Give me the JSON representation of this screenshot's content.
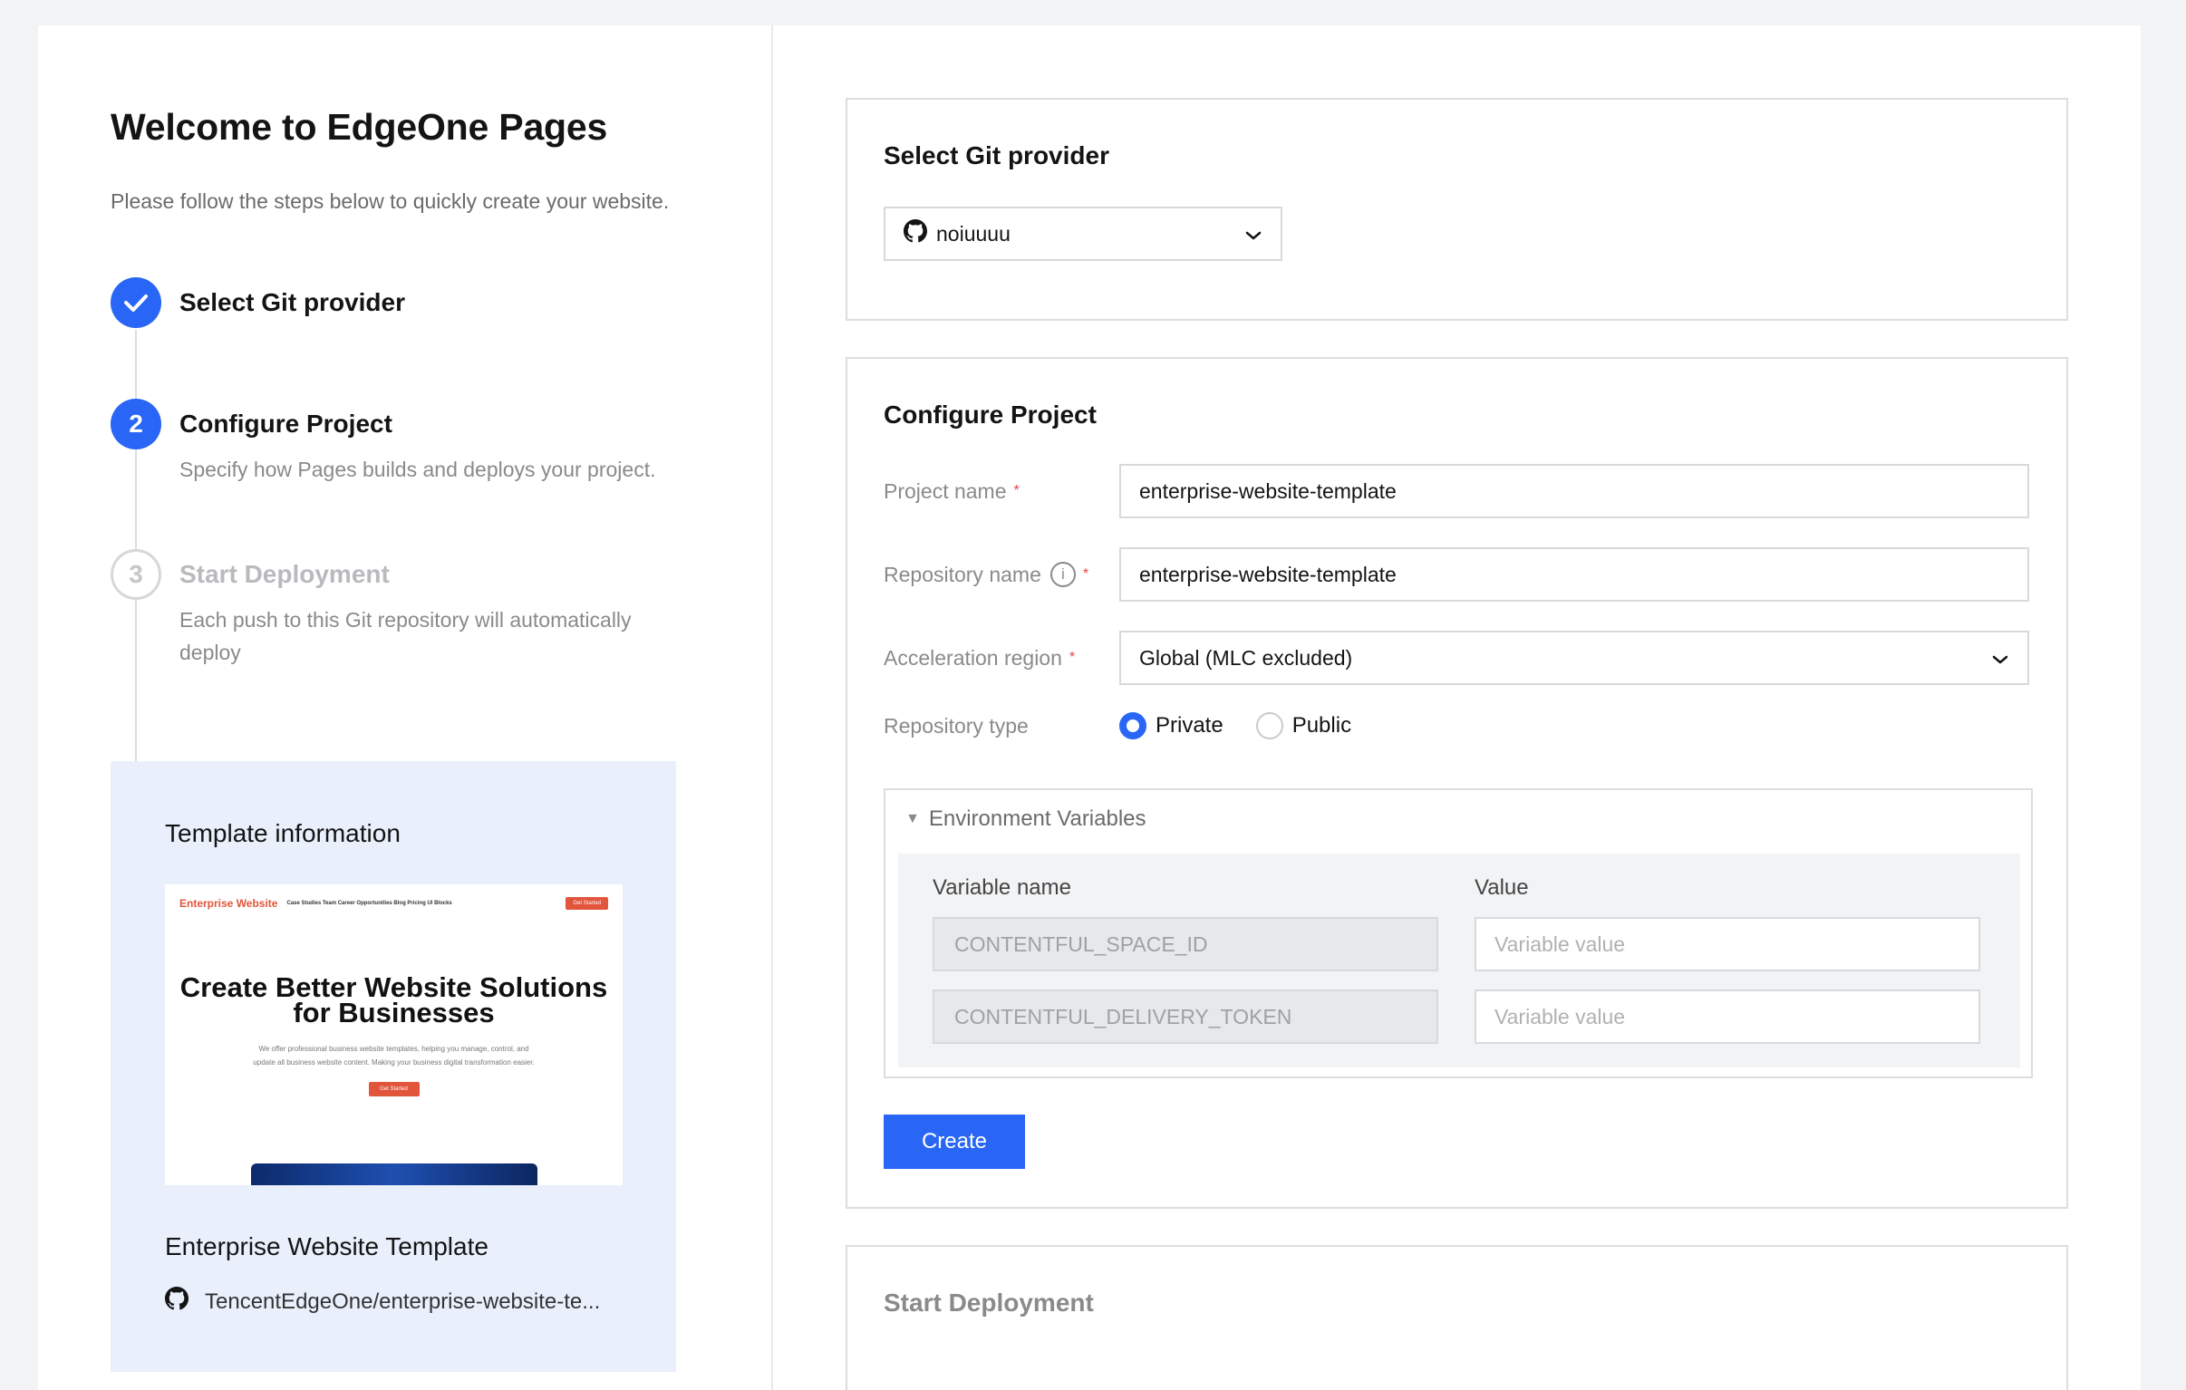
{
  "welcome": {
    "title": "Welcome to EdgeOne Pages",
    "subtitle": "Please follow the steps below to quickly create your website."
  },
  "steps": [
    {
      "number": "1",
      "title": "Select Git provider",
      "description": "",
      "state": "done"
    },
    {
      "number": "2",
      "title": "Configure Project",
      "description": "Specify how Pages builds and deploys your project.",
      "state": "active"
    },
    {
      "number": "3",
      "title": "Start Deployment",
      "description": "Each push to this Git repository will automatically deploy",
      "state": "pending"
    }
  ],
  "template": {
    "heading": "Template information",
    "preview": {
      "brand": "Enterprise Website",
      "links": "Case Studies Team Career Opportunities Blog Pricing UI Blocks",
      "nav_button": "Get Started",
      "hero": "Create Better Website Solutions for Businesses",
      "text": "We offer professional business website templates, helping you manage, control, and update all business website content. Making your business digital transformation easier.",
      "cta": "Get Started"
    },
    "name": "Enterprise Website Template",
    "repo": "TencentEdgeOne/enterprise-website-te..."
  },
  "git": {
    "title": "Select Git provider",
    "account": "noiuuuu"
  },
  "config": {
    "title": "Configure Project",
    "project_name_label": "Project name",
    "project_name_value": "enterprise-website-template",
    "repo_name_label": "Repository name",
    "repo_name_value": "enterprise-website-template",
    "region_label": "Acceleration region",
    "region_value": "Global (MLC excluded)",
    "repo_type_label": "Repository type",
    "repo_type_options": [
      "Private",
      "Public"
    ],
    "repo_type_selected": "Private",
    "env": {
      "title": "Environment Variables",
      "col_name": "Variable name",
      "col_value": "Value",
      "rows": [
        {
          "name": "CONTENTFUL_SPACE_ID",
          "value_placeholder": "Variable value"
        },
        {
          "name": "CONTENTFUL_DELIVERY_TOKEN",
          "value_placeholder": "Variable value"
        }
      ]
    },
    "create_button": "Create"
  },
  "deploy": {
    "title": "Start Deployment"
  },
  "colors": {
    "accent": "#2966f5",
    "required": "#e54545",
    "template_bg": "#e9f0fc"
  }
}
